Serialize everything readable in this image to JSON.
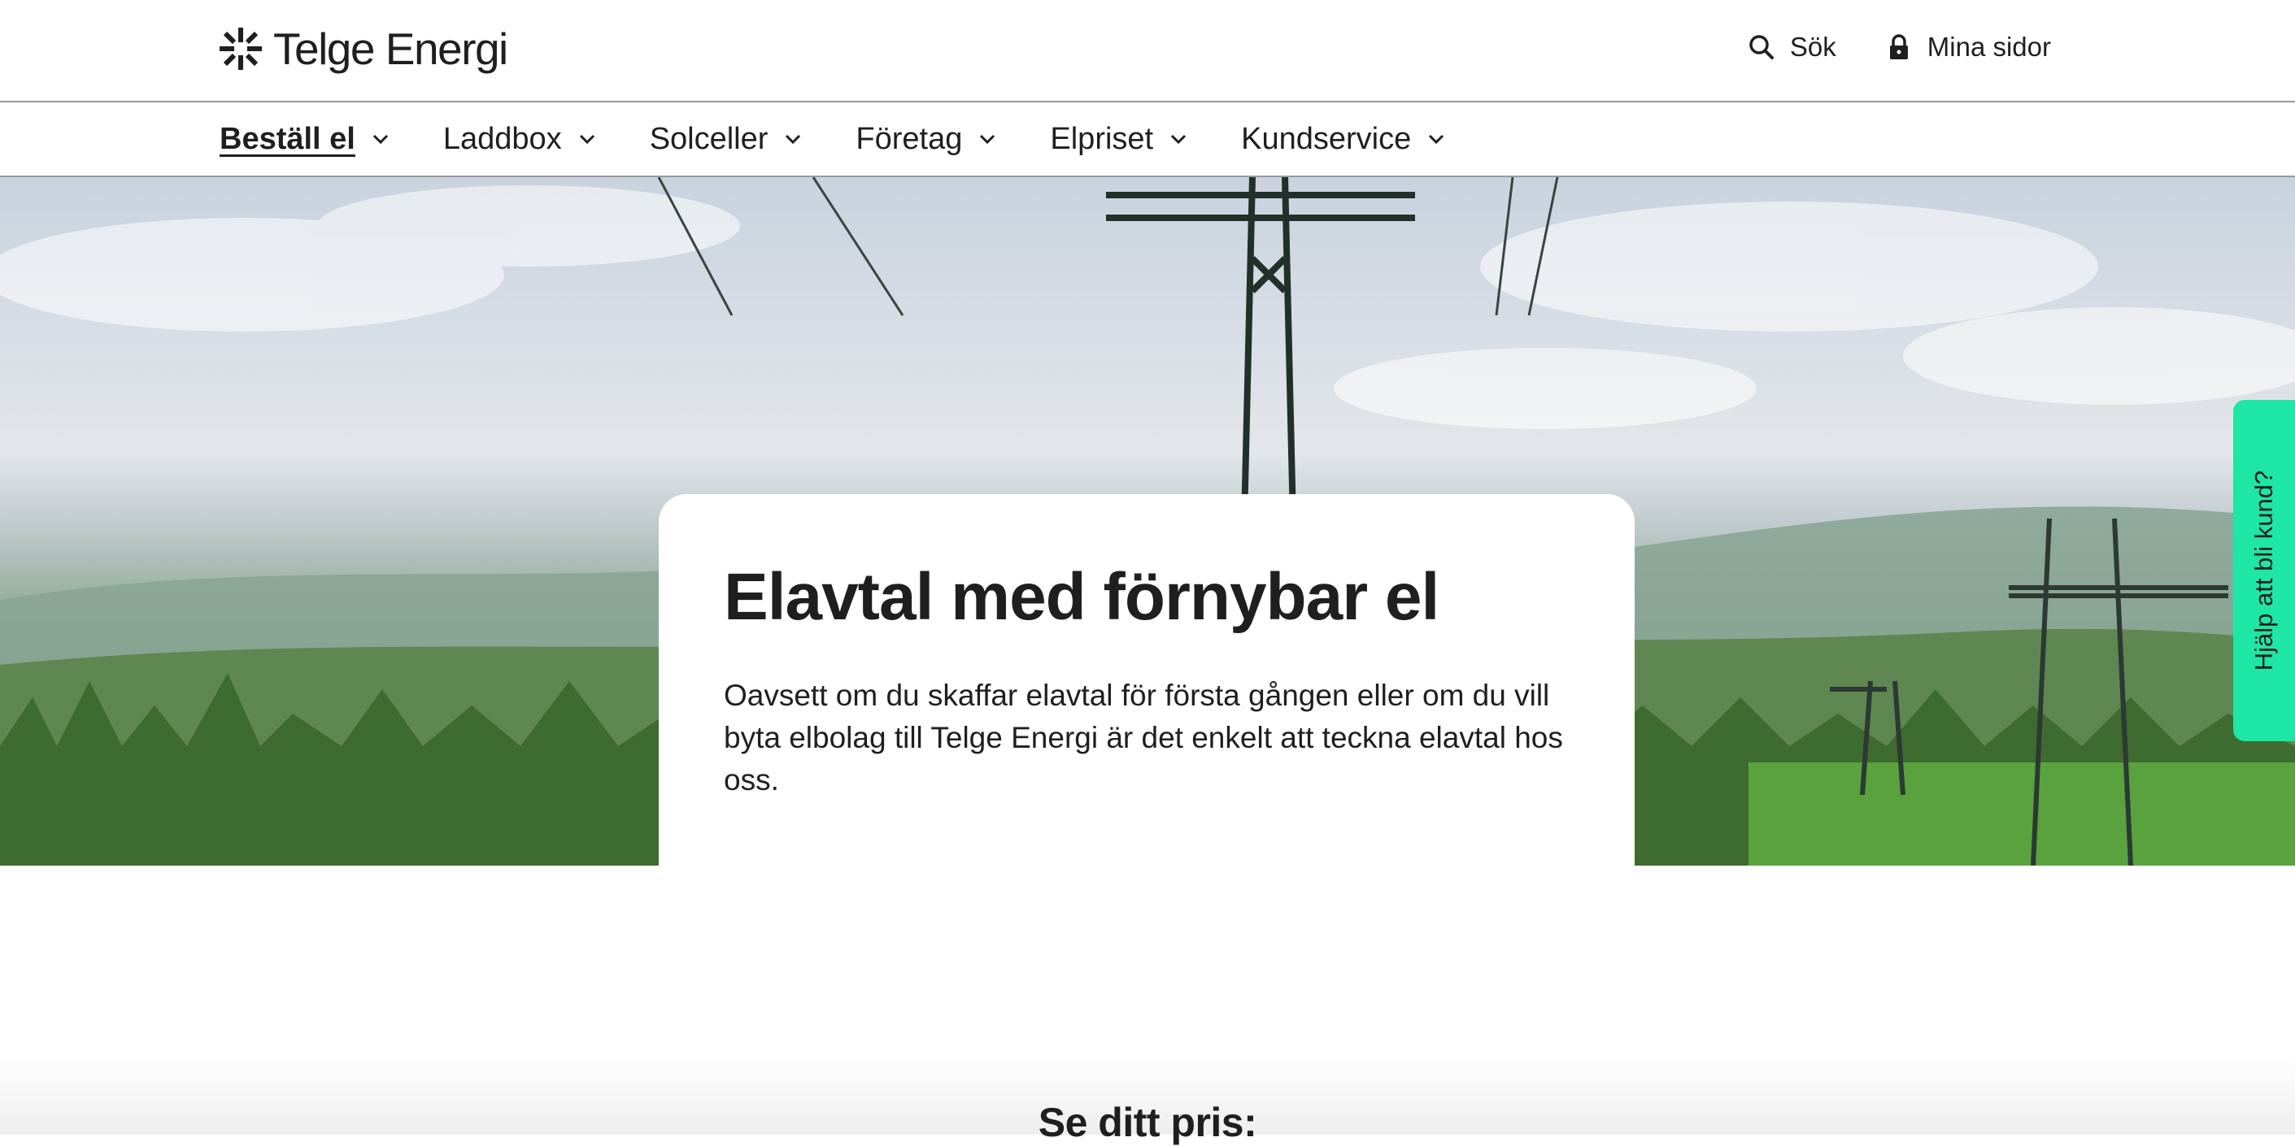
{
  "header": {
    "brand": "Telge Energi",
    "search_label": "Sök",
    "account_label": "Mina sidor"
  },
  "nav": {
    "items": [
      {
        "label": "Beställ el",
        "active": true
      },
      {
        "label": "Laddbox"
      },
      {
        "label": "Solceller"
      },
      {
        "label": "Företag"
      },
      {
        "label": "Elpriset"
      },
      {
        "label": "Kundservice"
      }
    ]
  },
  "hero": {
    "title": "Elavtal med förnybar el",
    "text": "Oavsett om du skaffar elavtal för första gången eller om du vill byta elbolag till Telge Energi är det enkelt att teckna elavtal hos oss."
  },
  "side_tab": {
    "label": "Hjälp att bli kund?"
  },
  "price_section": {
    "heading": "Se ditt pris:"
  },
  "colors": {
    "text": "#1f1f1f",
    "accent_green": "#1ee6a4",
    "divider": "#9a9a9a"
  }
}
